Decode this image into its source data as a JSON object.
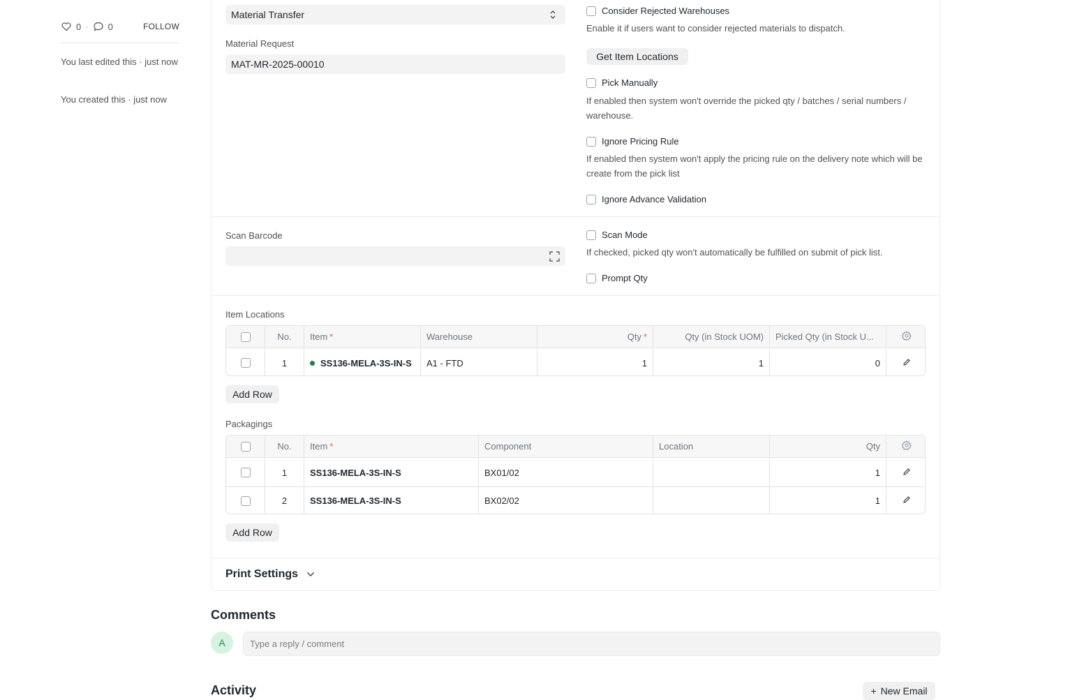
{
  "sidebar": {
    "likes": "0",
    "comments": "0",
    "follow_label": "FOLLOW",
    "last_edited": "You last edited this · just now",
    "created": "You created this · just now"
  },
  "form": {
    "purpose_value": "Material Transfer",
    "material_request_label": "Material Request",
    "material_request_value": "MAT-MR-2025-00010",
    "consider_rejected_label": "Consider Rejected Warehouses",
    "consider_rejected_desc": "Enable it if users want to consider rejected materials to dispatch.",
    "get_item_locations_label": "Get Item Locations",
    "pick_manually_label": "Pick Manually",
    "pick_manually_desc": "If enabled then system won't override the picked qty / batches / serial numbers / warehouse.",
    "ignore_pricing_label": "Ignore Pricing Rule",
    "ignore_pricing_desc": "If enabled then system won't apply the pricing rule on the delivery note which will be create from the pick list",
    "ignore_advance_label": "Ignore Advance Validation",
    "scan_barcode_label": "Scan Barcode",
    "scan_mode_label": "Scan Mode",
    "scan_mode_desc": "If checked, picked qty won't automatically be fulfilled on submit of pick list.",
    "prompt_qty_label": "Prompt Qty"
  },
  "item_locations": {
    "title": "Item Locations",
    "headers": {
      "no": "No.",
      "item": "Item",
      "warehouse": "Warehouse",
      "qty": "Qty",
      "stock_qty": "Qty (in Stock UOM)",
      "picked_qty": "Picked Qty (in Stock U..."
    },
    "rows": [
      {
        "no": "1",
        "item": "SS136-MELA-3S-IN-S",
        "warehouse": "A1 - FTD",
        "qty": "1",
        "stock_qty": "1",
        "picked_qty": "0"
      }
    ],
    "add_row_label": "Add Row"
  },
  "packagings": {
    "title": "Packagings",
    "headers": {
      "no": "No.",
      "item": "Item",
      "component": "Component",
      "location": "Location",
      "qty": "Qty"
    },
    "rows": [
      {
        "no": "1",
        "item": "SS136-MELA-3S-IN-S",
        "component": "BX01/02",
        "location": "",
        "qty": "1"
      },
      {
        "no": "2",
        "item": "SS136-MELA-3S-IN-S",
        "component": "BX02/02",
        "location": "",
        "qty": "1"
      }
    ],
    "add_row_label": "Add Row"
  },
  "print_settings_label": "Print Settings",
  "comments": {
    "title": "Comments",
    "avatar_initial": "A",
    "placeholder": "Type a reply / comment"
  },
  "activity": {
    "title": "Activity",
    "new_email_label": "New Email"
  },
  "colors": {
    "accent_green": "#1e7e4e",
    "required_red": "#e36363",
    "control_bg": "#f3f3f3"
  }
}
